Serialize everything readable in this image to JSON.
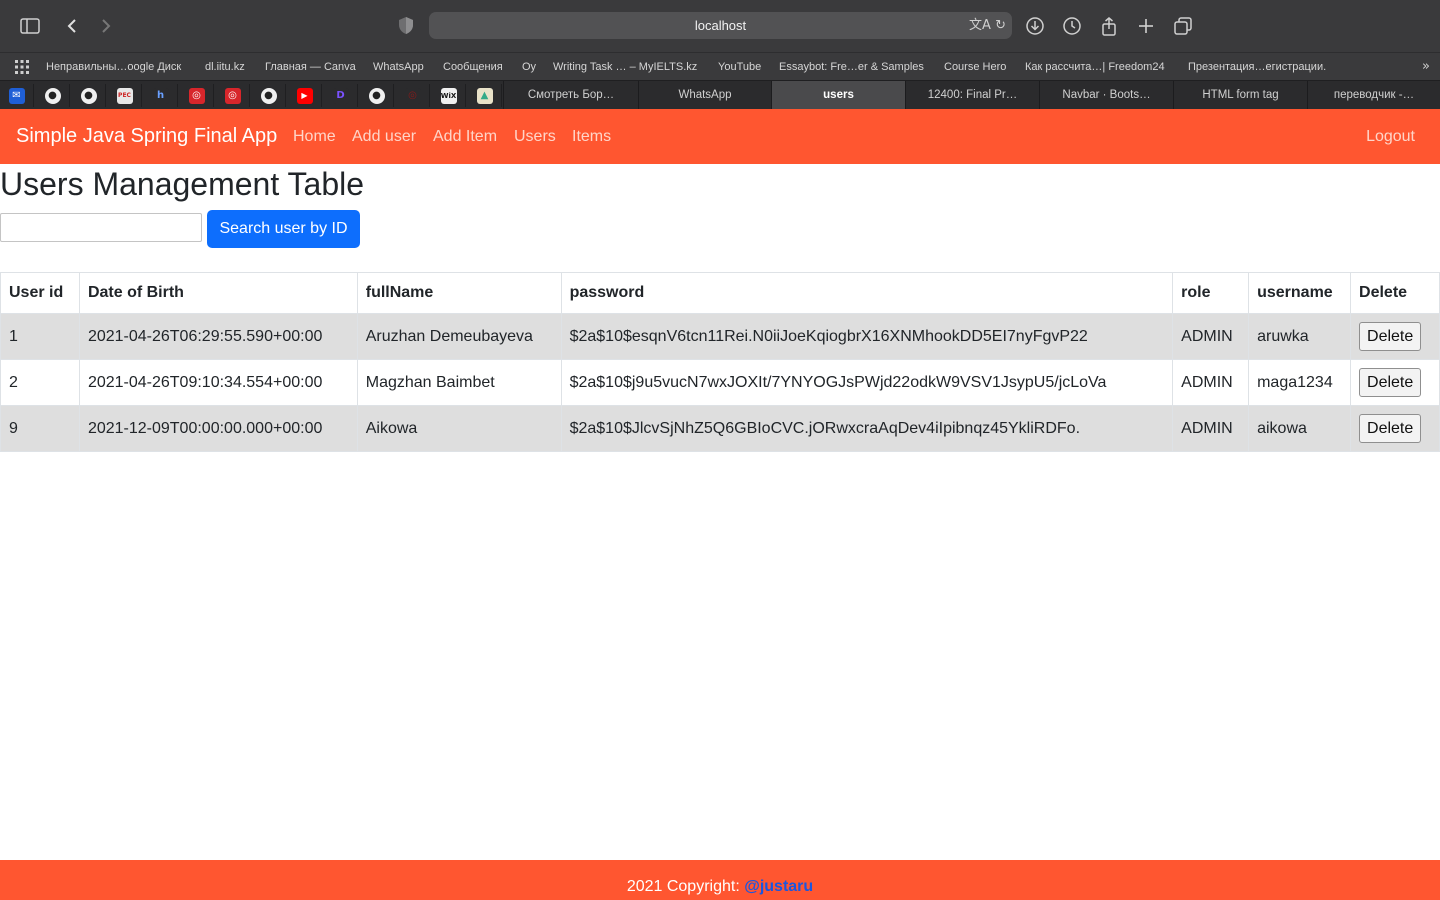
{
  "browser": {
    "url": "localhost",
    "bookmarks": [
      "Неправильны…oogle Диск",
      "dl.iitu.kz",
      "Главная — Canva",
      "WhatsApp",
      "Сообщения",
      "Оу",
      "Writing Task … – MyIELTS.kz",
      "YouTube",
      "Essaybot: Fre…er & Samples",
      "Course Hero",
      "Как рассчита…| Freedom24",
      "Презентация…егистрации."
    ],
    "pinned_tabs": [
      "mail-icon",
      "github-icon",
      "github-icon",
      "pechat-icon",
      "h-icon",
      "iitu-icon",
      "iitu-icon",
      "github-icon",
      "youtube-icon",
      "d-icon",
      "github-icon",
      "iitu-icon",
      "wix-icon",
      "drive-icon"
    ],
    "tabs": [
      {
        "label": "Смотреть Бор…",
        "active": false
      },
      {
        "label": "WhatsApp",
        "active": false
      },
      {
        "label": "users",
        "active": true
      },
      {
        "label": "12400: Final Pr…",
        "active": false
      },
      {
        "label": "Navbar · Boots…",
        "active": false
      },
      {
        "label": "HTML form tag",
        "active": false
      },
      {
        "label": "переводчик -…",
        "active": false
      }
    ]
  },
  "navbar": {
    "brand": "Simple Java Spring Final App",
    "links": [
      "Home",
      "Add user",
      "Add Item",
      "Users",
      "Items"
    ],
    "logout": "Logout",
    "color": "#ff5630"
  },
  "main": {
    "title": "Users Management Table",
    "search": {
      "value": "",
      "button_label": "Search user by ID"
    },
    "table": {
      "headers": [
        "User id",
        "Date of Birth",
        "fullName",
        "password",
        "role",
        "username",
        "Delete"
      ],
      "rows": [
        {
          "id": "1",
          "dob": "2021-04-26T06:29:55.590+00:00",
          "fullName": "Aruzhan Demeubayeva",
          "password": "$2a$10$esqnV6tcn11Rei.N0iiJoeKqiogbrX16XNMhookDD5EI7nyFgvP22",
          "role": "ADMIN",
          "username": "aruwka",
          "delete": "Delete"
        },
        {
          "id": "2",
          "dob": "2021-04-26T09:10:34.554+00:00",
          "fullName": "Magzhan Baimbet",
          "password": "$2a$10$j9u5vucN7wxJOXIt/7YNYOGJsPWjd22odkW9VSV1JsypU5/jcLoVa",
          "role": "ADMIN",
          "username": "maga1234",
          "delete": "Delete"
        },
        {
          "id": "9",
          "dob": "2021-12-09T00:00:00.000+00:00",
          "fullName": "Aikowa",
          "password": "$2a$10$JlcvSjNhZ5Q6GBIoCVC.jORwxcraAqDev4iIpibnqz45YkliRDFo.",
          "role": "ADMIN",
          "username": "aikowa",
          "delete": "Delete"
        }
      ]
    }
  },
  "footer": {
    "text": "2021 Copyright: ",
    "link": "@justaru"
  }
}
